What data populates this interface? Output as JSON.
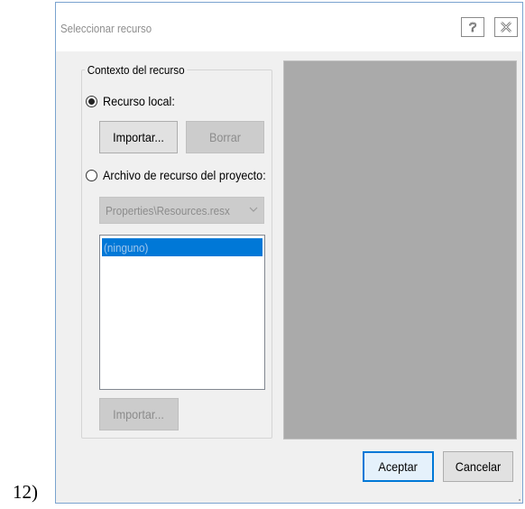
{
  "caption": "12)",
  "dialog": {
    "title": "Seleccionar recurso",
    "help_label": "?",
    "close_label": "X"
  },
  "context_group": {
    "label": "Contexto del recurso",
    "local_radio": {
      "label": "Recurso local:",
      "checked": true
    },
    "import_local_label": "Importar...",
    "clear_label": "Borrar",
    "project_radio": {
      "label": "Archivo de recurso del proyecto:",
      "checked": false
    },
    "resource_file_value": "Properties\\Resources.resx",
    "resource_list": [
      "(ninguno)"
    ],
    "import_project_label": "Importar..."
  },
  "footer": {
    "ok_label": "Aceptar",
    "cancel_label": "Cancelar"
  },
  "colors": {
    "accent": "#0078d7",
    "preview_bg": "#aaaaaa",
    "dialog_bg": "#f0f0f0"
  }
}
